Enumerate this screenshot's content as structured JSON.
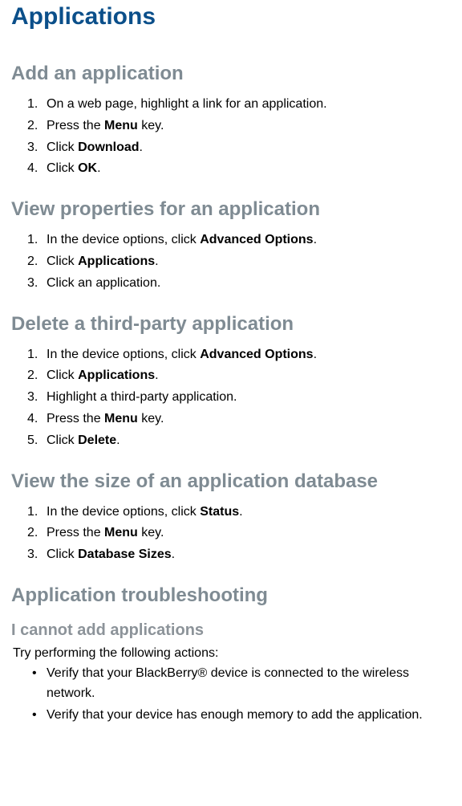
{
  "title": "Applications",
  "sections": [
    {
      "heading": "Add an application",
      "steps_html": [
        "On a web page, highlight a link for an application.",
        "Press the <b>Menu</b> key.",
        "Click <b>Download</b>.",
        "Click <b>OK</b>."
      ]
    },
    {
      "heading": "View properties for an application",
      "steps_html": [
        "In the device options, click <b>Advanced Options</b>.",
        "Click <b>Applications</b>.",
        "Click an application."
      ]
    },
    {
      "heading": "Delete a third-party application",
      "steps_html": [
        "In the device options, click <b>Advanced Options</b>.",
        "Click <b>Applications</b>.",
        "Highlight a third-party application.",
        "Press the <b>Menu</b> key.",
        "Click <b>Delete</b>."
      ]
    },
    {
      "heading": "View the size of an application database",
      "steps_html": [
        "In the device options, click <b>Status</b>.",
        "Press the <b>Menu</b> key.",
        "Click <b>Database Sizes</b>."
      ]
    }
  ],
  "troubleshooting": {
    "heading": "Application troubleshooting",
    "sub_heading": "I cannot add applications",
    "intro": "Try performing the following actions:",
    "bullets": [
      "Verify that your BlackBerry® device is connected to the wireless network.",
      "Verify that your device has enough memory to add the application."
    ]
  }
}
